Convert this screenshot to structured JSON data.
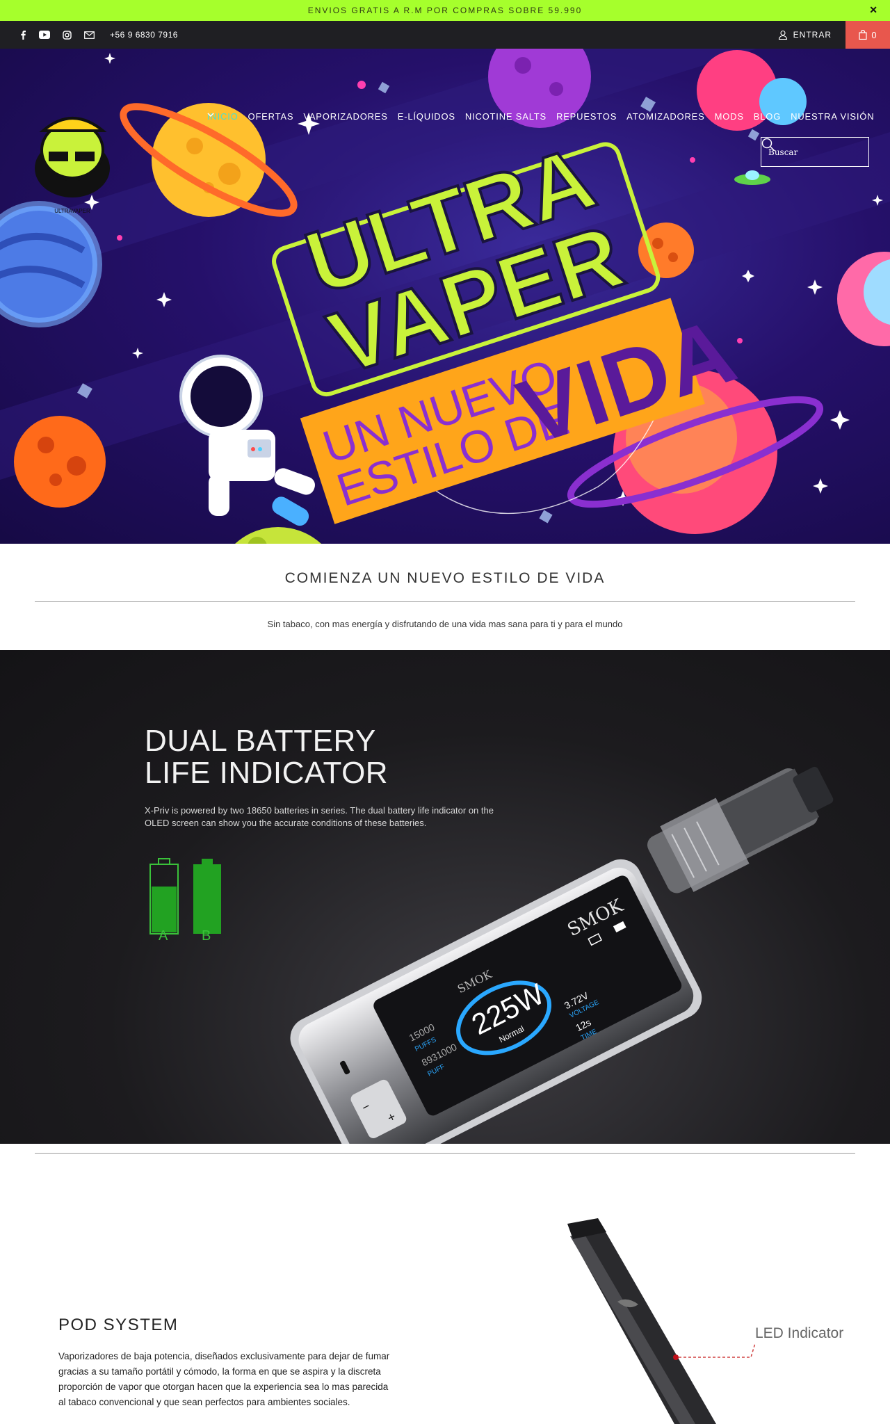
{
  "announcement": {
    "text": "ENVIOS GRATIS A R.M  POR COMPRAS SOBRE 59.990",
    "close_label": "✕"
  },
  "topbar": {
    "social": [
      "facebook-icon",
      "youtube-icon",
      "instagram-icon",
      "email-icon"
    ],
    "phone": "+56 9 6830 7916",
    "login_label": "ENTRAR",
    "cart_count": "0"
  },
  "hero": {
    "logo_text": "ULTRAVAPER",
    "nav": [
      {
        "label": "INICIO",
        "active": true,
        "dropdown": false
      },
      {
        "label": "OFERTAS",
        "active": false,
        "dropdown": false
      },
      {
        "label": "VAPORIZADORES",
        "active": false,
        "dropdown": true
      },
      {
        "label": "E-LÍQUIDOS",
        "active": false,
        "dropdown": true
      },
      {
        "label": "NICOTINE SALTS",
        "active": false,
        "dropdown": true
      },
      {
        "label": "REPUESTOS",
        "active": false,
        "dropdown": true
      },
      {
        "label": "ATOMIZADORES",
        "active": false,
        "dropdown": false
      },
      {
        "label": "MODS",
        "active": false,
        "dropdown": false
      },
      {
        "label": "BLOG",
        "active": false,
        "dropdown": false
      },
      {
        "label": "NUESTRA VISIÓN",
        "active": false,
        "dropdown": false
      }
    ],
    "search_placeholder": "Buscar",
    "headline_1": "ULTRA",
    "headline_2": "VAPER",
    "tagline_1": "UN NUEVO",
    "tagline_2": "ESTILO DE",
    "tagline_big": "VIDA"
  },
  "intro": {
    "title": "COMIENZA UN NUEVO ESTILO DE VIDA",
    "subtitle": "Sin tabaco, con mas energía y disfrutando de una vida mas sana para ti y para el mundo"
  },
  "product_banner": {
    "title_line_1": "DUAL BATTERY",
    "title_line_2": "LIFE INDICATOR",
    "description": "X-Priv is powered by two 18650 batteries in series. The dual battery life indicator on the OLED screen can show you the accurate conditions of these batteries.",
    "battery_a": "A",
    "battery_b": "B",
    "brand_1": "SMOK",
    "brand_2": "SMOK",
    "watt": "225W",
    "mode": "Normal",
    "puffs": "15000",
    "puffs_label": "PUFFS",
    "puff_count": "8931000",
    "puff_label2": "PUFF",
    "voltage": "3.72V",
    "voltage_label": "VOLTAGE",
    "time": "12s",
    "time_label": "TIME"
  },
  "pod": {
    "title": "POD SYSTEM",
    "description": "Vaporizadores de baja potencia, diseñados exclusivamente para dejar de fumar gracias a su tamaño portátil y cómodo, la forma en que se aspira y la discreta proporción de vapor que otorgan hacen que la experiencia sea lo mas parecida al tabaco convencional y que sean perfectos para ambientes sociales.",
    "led_label": "LED Indicator"
  },
  "colors": {
    "accent_green": "#a6ff2c",
    "topbar": "#1f1f23",
    "cart": "#e8574d",
    "nav_active": "#49e0d0"
  }
}
